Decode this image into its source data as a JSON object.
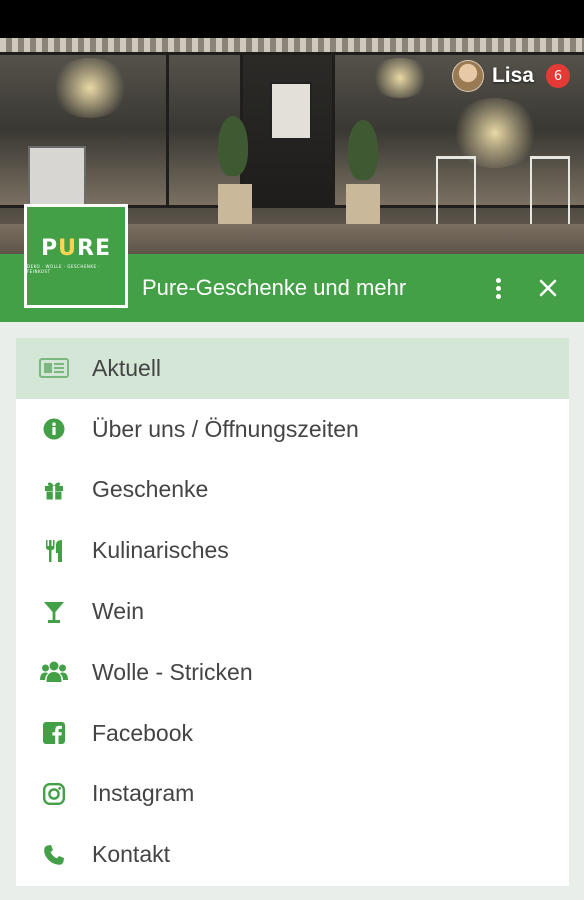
{
  "header": {
    "user": {
      "name": "Lisa",
      "notification_count": "6"
    },
    "logo": {
      "word_pre": "P",
      "word_mid": "U",
      "word_post": "RE",
      "tagline": "DEKO · WOLLE · GESCHENKE · FEINKOST"
    },
    "title": "Pure-Geschenke und mehr"
  },
  "menu": {
    "items": [
      {
        "label": "Aktuell",
        "icon": "newspaper-icon",
        "active": true
      },
      {
        "label": "Über uns / Öffnungszeiten",
        "icon": "info-icon",
        "active": false
      },
      {
        "label": "Geschenke",
        "icon": "gift-icon",
        "active": false
      },
      {
        "label": "Kulinarisches",
        "icon": "cutlery-icon",
        "active": false
      },
      {
        "label": "Wein",
        "icon": "cocktail-glass-icon",
        "active": false
      },
      {
        "label": "Wolle - Stricken",
        "icon": "users-icon",
        "active": false
      },
      {
        "label": "Facebook",
        "icon": "facebook-icon",
        "active": false
      },
      {
        "label": "Instagram",
        "icon": "instagram-icon",
        "active": false
      },
      {
        "label": "Kontakt",
        "icon": "phone-icon",
        "active": false
      }
    ]
  },
  "colors": {
    "brand": "#43a047",
    "active_bg": "#d4e7d6",
    "badge": "#e53935"
  }
}
